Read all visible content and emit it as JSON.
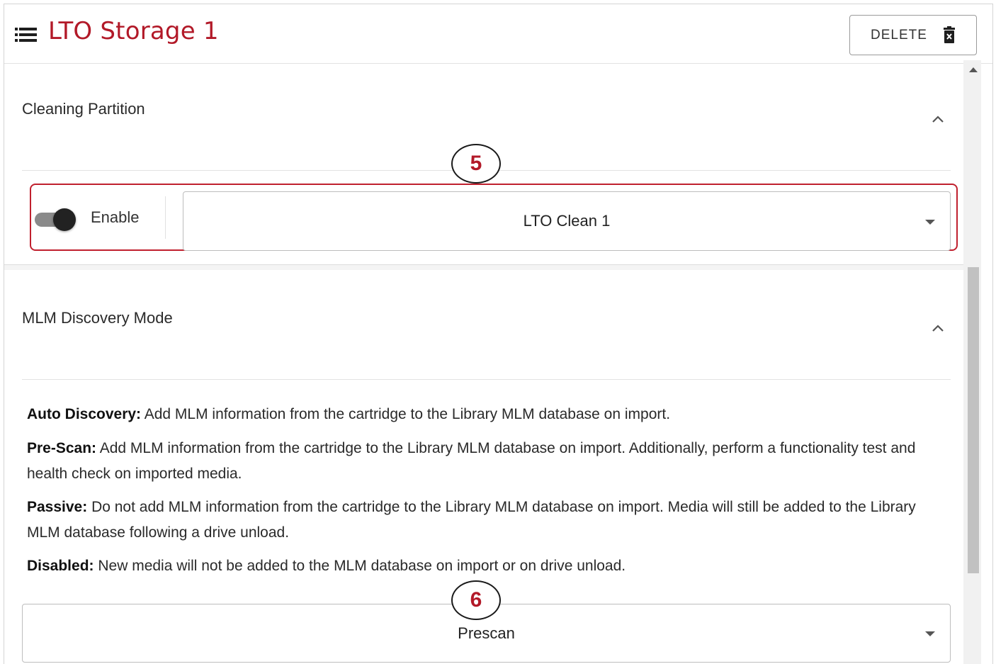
{
  "header": {
    "title": "LTO Storage 1",
    "delete_label": "DELETE"
  },
  "cleaning_partition": {
    "title": "Cleaning Partition",
    "enable_label": "Enable",
    "enabled": true,
    "selected": "LTO Clean 1",
    "callout": "5"
  },
  "mlm_discovery": {
    "title": "MLM Discovery Mode",
    "options": [
      {
        "term": "Auto Discovery:",
        "text": " Add MLM information from the cartridge to the Library MLM database on import."
      },
      {
        "term": "Pre-Scan:",
        "text": " Add MLM information from the cartridge to the Library MLM database on import. Additionally, perform a functionality test and health check on imported media."
      },
      {
        "term": "Passive:",
        "text": " Do not add MLM information from the cartridge to the Library MLM database on import. Media will still be added to the Library MLM database following a drive unload."
      },
      {
        "term": "Disabled:",
        "text": " New media will not be added to the MLM database on import or on drive unload."
      }
    ],
    "selected": "Prescan",
    "callout": "6"
  },
  "colors": {
    "brand_red": "#b21928",
    "highlight_red": "#c0202e"
  },
  "icons": {
    "menu": "menu-list-icon",
    "delete": "trash-icon",
    "collapse": "chevron-up-icon",
    "dropdown": "caret-down-icon"
  }
}
